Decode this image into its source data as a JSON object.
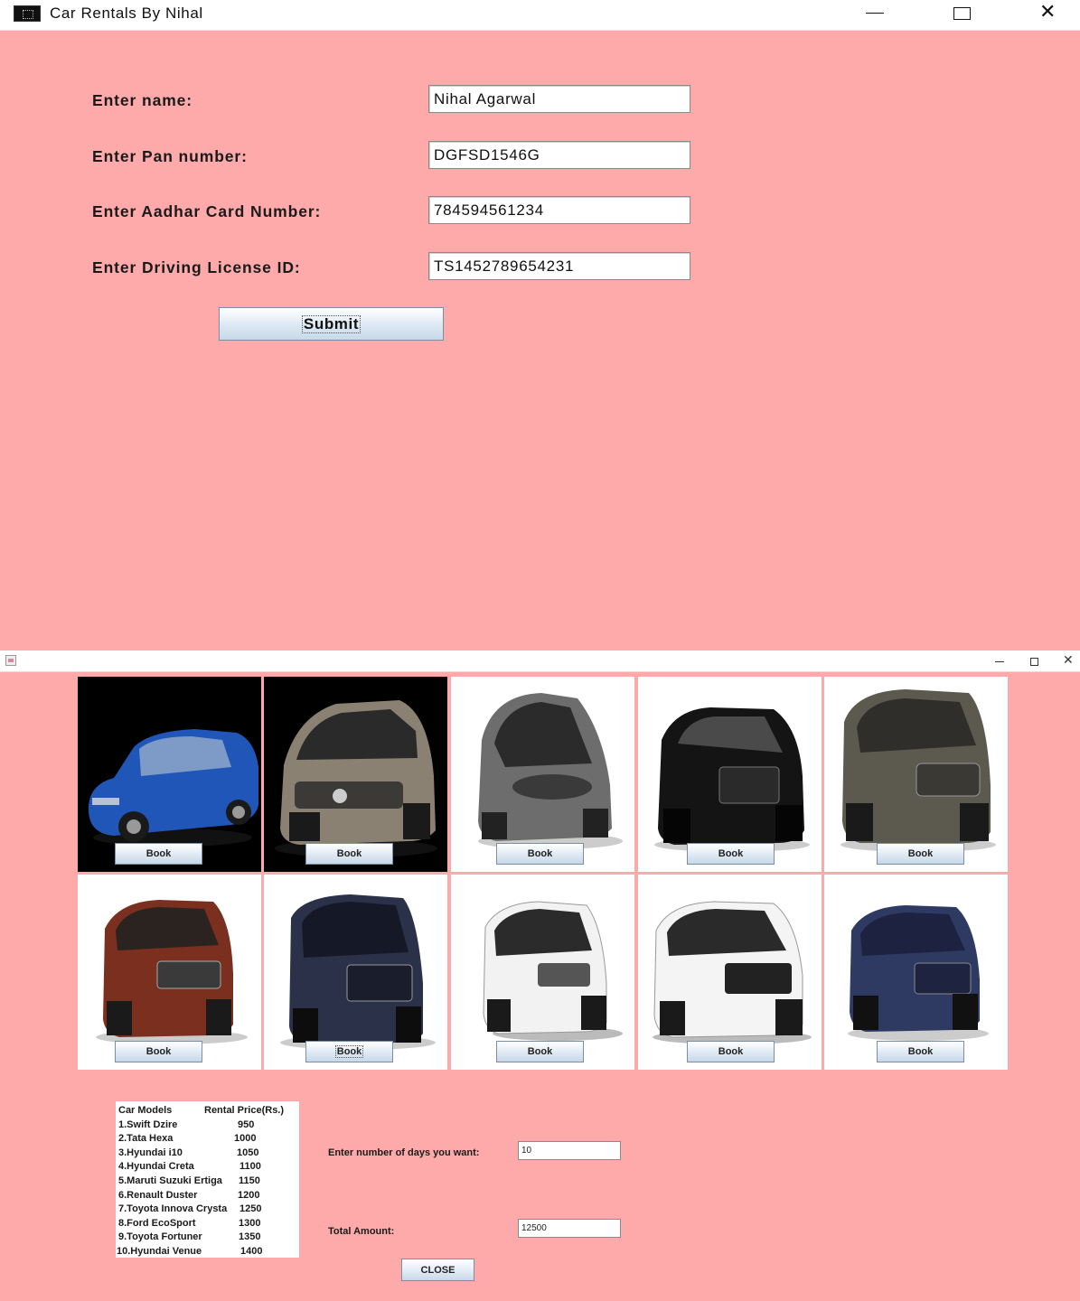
{
  "form_window": {
    "title": "Car Rentals By Nihal",
    "fields": [
      {
        "label": "Enter name:",
        "value": "Nihal Agarwal"
      },
      {
        "label": "Enter Pan number:",
        "value": "DGFSD1546G"
      },
      {
        "label": "Enter Aadhar Card Number:",
        "value": "784594561234"
      },
      {
        "label": "Enter Driving License ID:",
        "value": "TS1452789654231"
      }
    ],
    "submit_label": "Submit"
  },
  "booking_window": {
    "book_label": "Book",
    "cars": [
      {
        "name": "Swift Dzire",
        "color": "#1f56b8",
        "background": "#000000"
      },
      {
        "name": "Tata Hexa",
        "color": "#8a8172",
        "background": "#000000"
      },
      {
        "name": "Hyundai i10",
        "color": "#6d6d6d",
        "background": "#ffffff"
      },
      {
        "name": "Hyundai Creta",
        "color": "#141414",
        "background": "#ffffff"
      },
      {
        "name": "Maruti Suzuki Ertiga",
        "color": "#5c5a4f",
        "background": "#ffffff"
      },
      {
        "name": "Renault Duster",
        "color": "#7a2f1f",
        "background": "#ffffff"
      },
      {
        "name": "Toyota Innova Crysta",
        "color": "#2b3148",
        "background": "#ffffff"
      },
      {
        "name": "Ford EcoSport",
        "color": "#f2f2f2",
        "background": "#ffffff"
      },
      {
        "name": "Toyota Fortuner",
        "color": "#f4f4f4",
        "background": "#ffffff"
      },
      {
        "name": "Hyundai Venue",
        "color": "#2f3a63",
        "background": "#ffffff"
      }
    ],
    "price_table": {
      "header_model": "Car Models",
      "header_price": "Rental Price(Rs.)",
      "rows": [
        {
          "model": "1.Swift Dzire",
          "price": "950"
        },
        {
          "model": "2.Tata Hexa",
          "price": "1000"
        },
        {
          "model": "3.Hyundai i10",
          "price": "1050"
        },
        {
          "model": "4.Hyundai Creta",
          "price": "1100"
        },
        {
          "model": "5.Maruti Suzuki Ertiga",
          "price": "1150"
        },
        {
          "model": "6.Renault Duster",
          "price": "1200"
        },
        {
          "model": "7.Toyota Innova Crysta",
          "price": "1250"
        },
        {
          "model": "8.Ford EcoSport",
          "price": "1300"
        },
        {
          "model": "9.Toyota Fortuner",
          "price": "1350"
        },
        {
          "model": "10.Hyundai Venue",
          "price": "1400"
        }
      ]
    },
    "days_label": "Enter number of days you want:",
    "days_value": "10",
    "total_label": "Total Amount:",
    "total_value": "12500",
    "close_label": "CLOSE"
  },
  "icons": [
    "app-icon",
    "minimize-icon",
    "maximize-icon",
    "close-icon"
  ]
}
